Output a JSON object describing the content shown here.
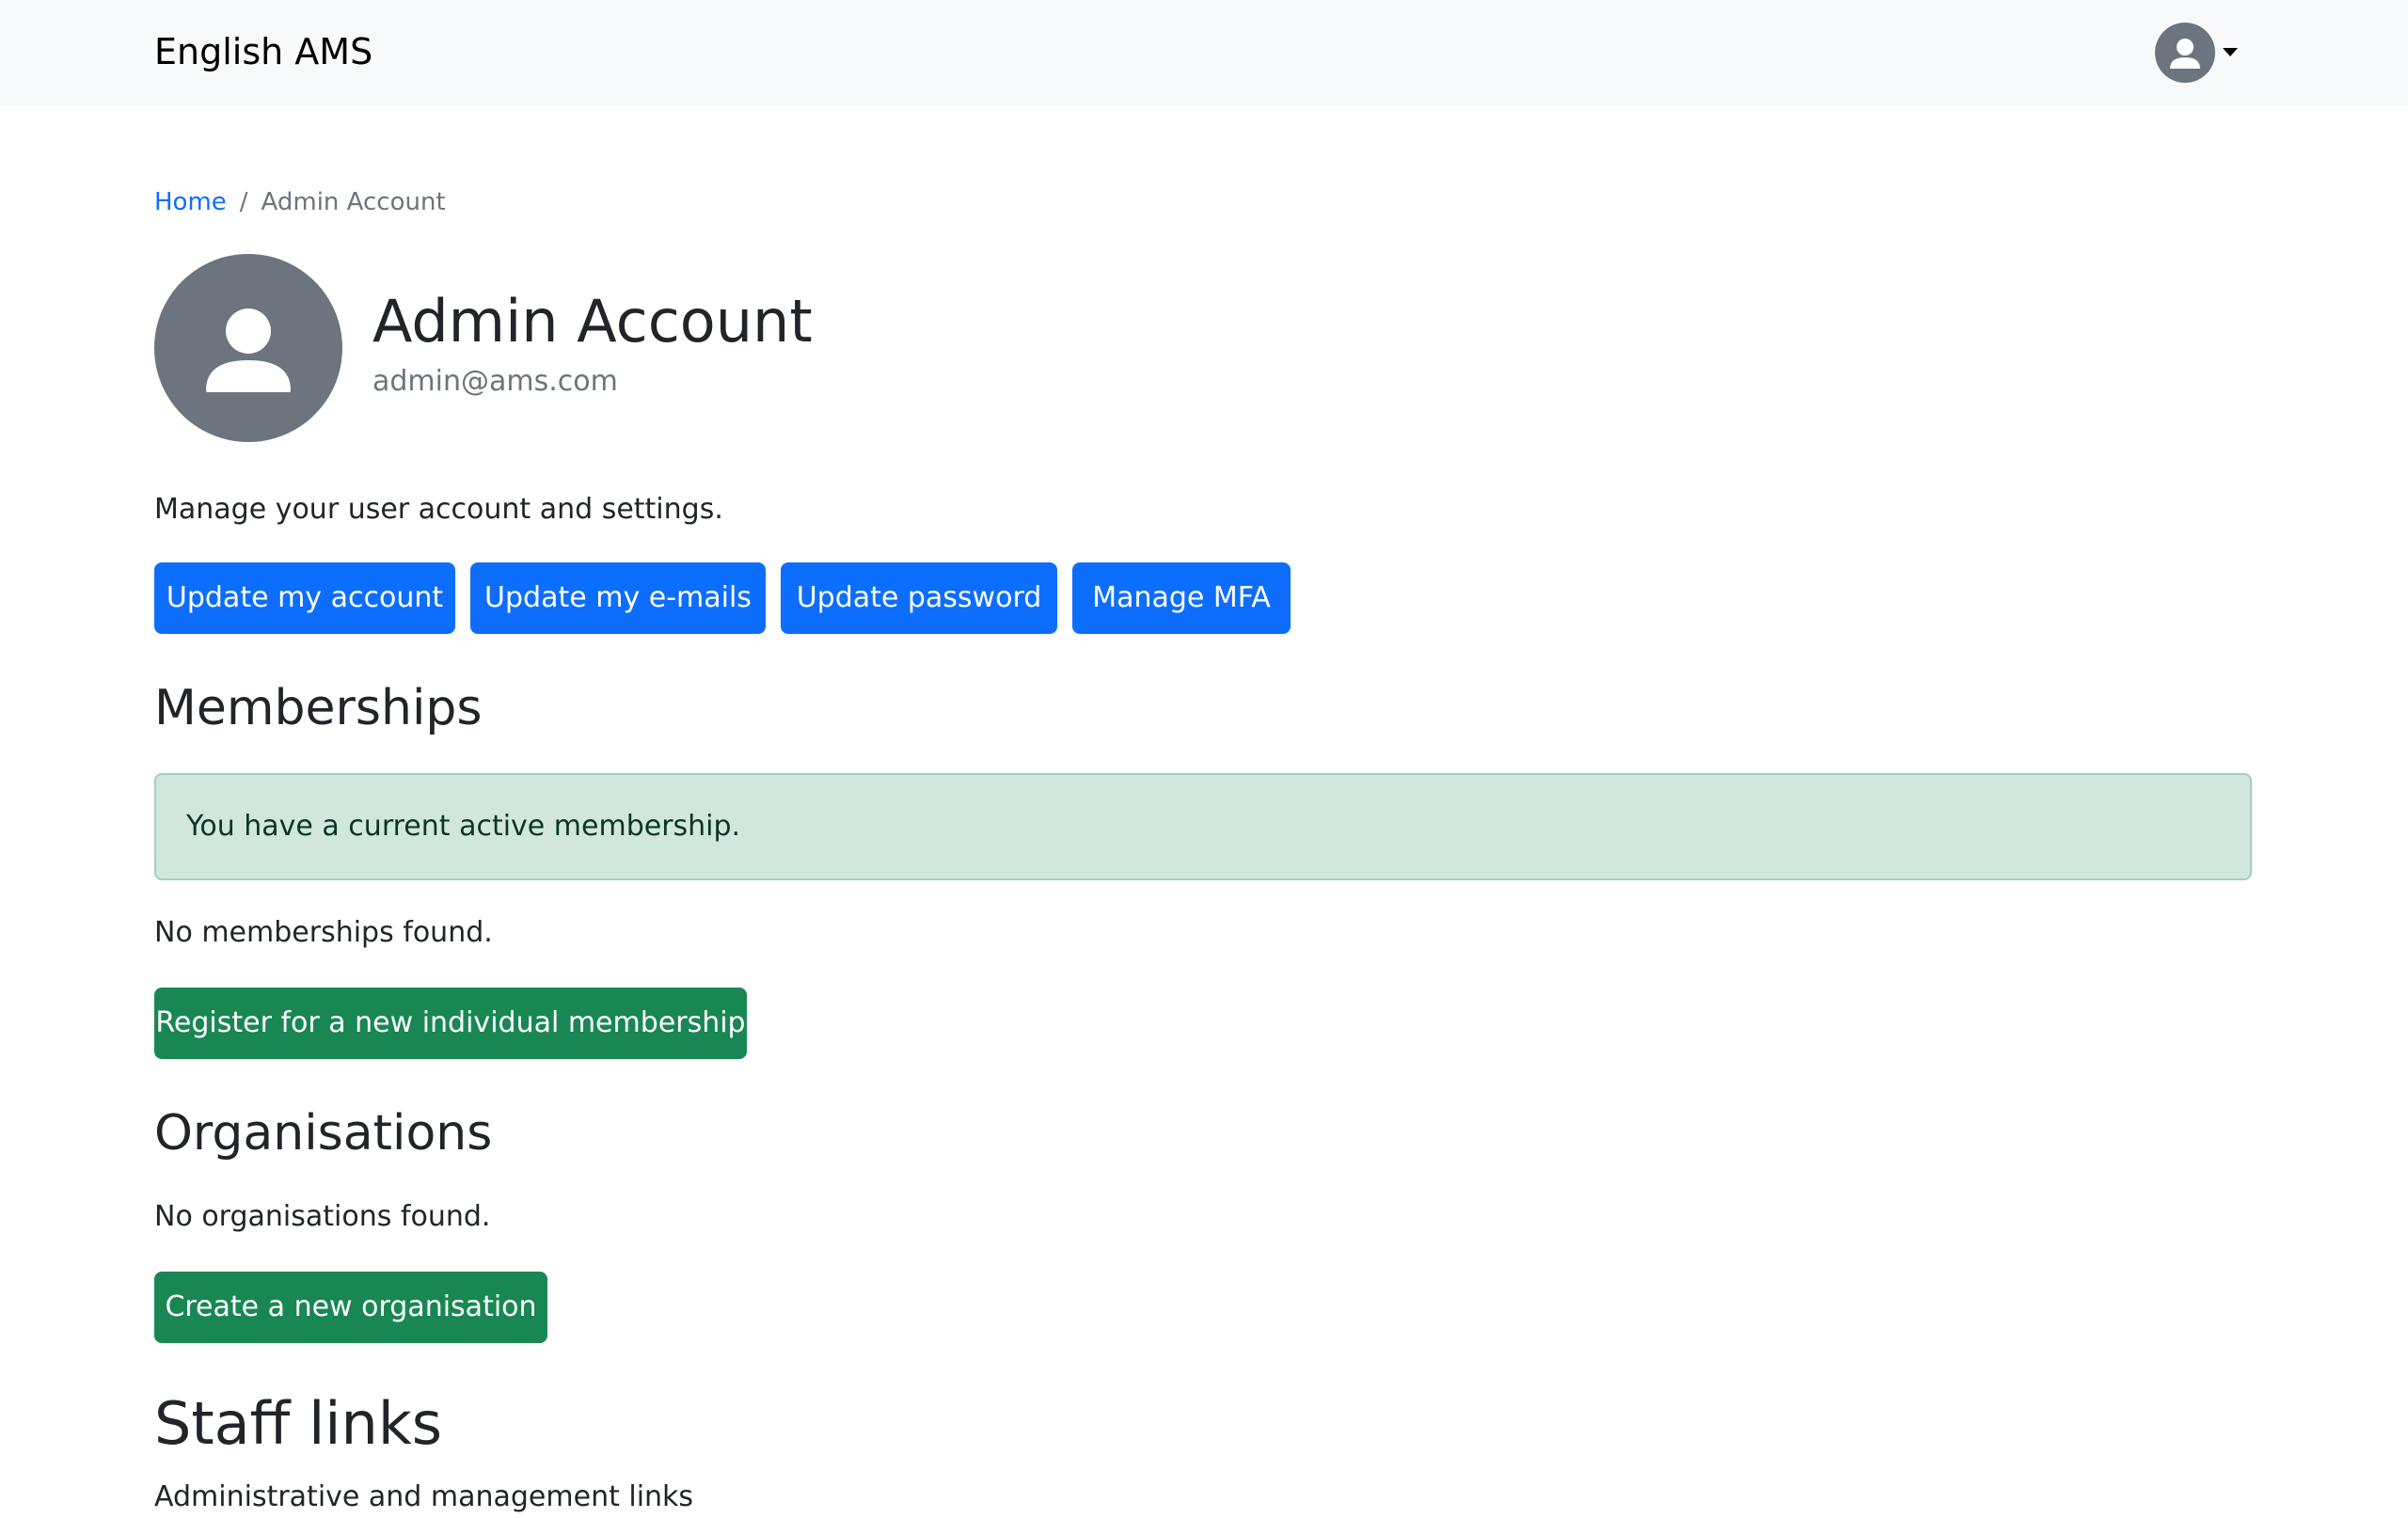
{
  "navbar": {
    "brand": "English AMS",
    "user_menu_icon": "user-circle-icon",
    "dropdown_icon": "caret-down-icon"
  },
  "breadcrumb": {
    "home": "Home",
    "separator": "/",
    "current": "Admin Account"
  },
  "profile": {
    "avatar_icon": "user-icon",
    "name": "Admin Account",
    "email": "admin@ams.com"
  },
  "intro": "Manage your user account and settings.",
  "account_actions": {
    "update_account": "Update my account",
    "update_emails": "Update my e-mails",
    "update_password": "Update password",
    "manage_mfa": "Manage MFA"
  },
  "memberships": {
    "heading": "Memberships",
    "alert": "You have a current active membership.",
    "empty": "No memberships found.",
    "register_button": "Register for a new individual membership"
  },
  "organisations": {
    "heading": "Organisations",
    "empty": "No organisations found.",
    "create_button": "Create a new organisation"
  },
  "staff_links": {
    "heading": "Staff links",
    "description": "Administrative and management links"
  },
  "colors": {
    "primary": "#0d6efd",
    "success": "#198754",
    "secondary": "#6c757d",
    "navbar_bg": "#f8f9fa",
    "alert_bg": "#d1e7dd"
  }
}
